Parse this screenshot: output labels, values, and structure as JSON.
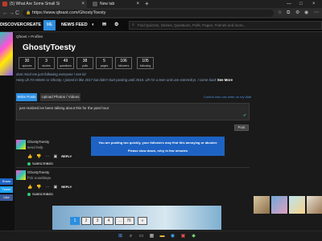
{
  "browser": {
    "tabs": [
      {
        "title": "(5) What Are Some Small Si",
        "close": "×"
      },
      {
        "title": "New tab",
        "close": "×"
      }
    ],
    "new_tab": "+",
    "window_controls": [
      "—",
      "□",
      "×"
    ],
    "url": "https://www.qfeast.com/GhostyToesty",
    "nav": {
      "back": "←",
      "forward": "→",
      "reload": "C"
    }
  },
  "site_nav": {
    "items": [
      "DISCOVER",
      "CREATE",
      "ME",
      "NEWS FEED"
    ],
    "search_placeholder": "Find Quizzes, Stories, Questions, Polls, Pages, Friends and more..."
  },
  "breadcrumb": "Qfeast » Profiles",
  "profile": {
    "name": "GhostyToesty",
    "stats": [
      {
        "num": "30",
        "label": "quizzes"
      },
      {
        "num": "3",
        "label": "stories"
      },
      {
        "num": "49",
        "label": "questions"
      },
      {
        "num": "38",
        "label": "polls"
      },
      {
        "num": "5",
        "label": "pages"
      },
      {
        "num": "106",
        "label": "followers"
      },
      {
        "num": "105",
        "label": "following"
      }
    ],
    "bio_line1": "dont mind me just following everyone i see lol",
    "bio_line2": "Heey uh I'm Winter or Ghosty. I joined in like 2017 but didn't start posting until 2018. Uh I'm a teen and use extremlcyr. I came back",
    "see_more": "See More"
  },
  "composer": {
    "tab_write": "Write Posts",
    "tab_upload": "Upload Photos / Videos",
    "control": "Control who can write on my Wall",
    "text": "just realized ive been talking about this for the past hour",
    "post_button": "Post"
  },
  "toast": {
    "line1": "You are posting too quickly, your followers may find this annoying or abusive",
    "line2": "Please slow down, retry in few minutes"
  },
  "posts": [
    {
      "user": "GhostyToesty",
      "text": "send help",
      "reply": "REPLY",
      "subscribed": "SUBSCRIBED"
    },
    {
      "user": "GhostyToesty",
      "text": "f*ck nosebleps",
      "reply": "REPLY",
      "subscribed": "SUBSCRIBED"
    }
  ],
  "sidebuttons": [
    "Share",
    "Tweet",
    "Like"
  ],
  "pagination": [
    "1",
    "2",
    "3",
    "4",
    "...",
    "76",
    "»"
  ],
  "colors": {
    "accent": "#2d8ee0",
    "toast": "#1e63c4",
    "success": "#2ecc71"
  }
}
